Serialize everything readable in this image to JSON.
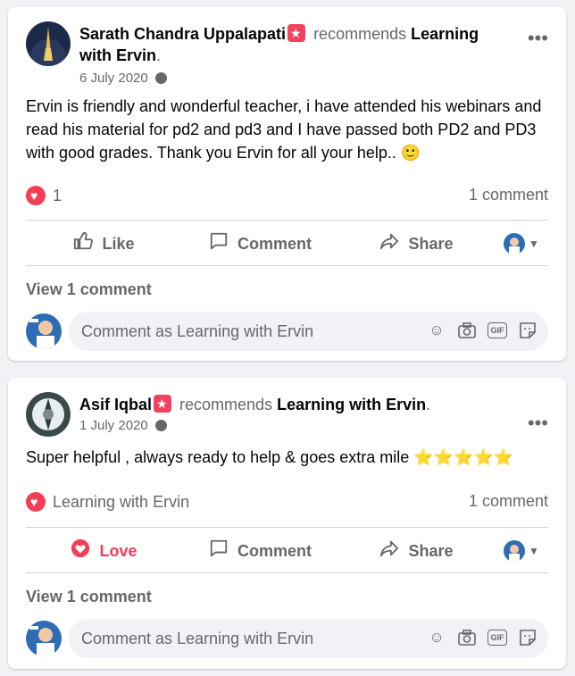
{
  "posts": [
    {
      "author": "Sarath Chandra Uppalapati",
      "recommends_text": "recommends",
      "page_name": "Learning with Ervin",
      "date": "6 July 2020",
      "body": "Ervin is friendly and wonderful teacher, i have attended his webinars and read his material for pd2 and pd3 and I have passed both PD2 and PD3 with good grades. Thank you Ervin for all your help..",
      "body_emoji": "🙂",
      "reaction_count": "1",
      "comment_count": "1 comment",
      "actions": {
        "like": "Like",
        "comment": "Comment",
        "share": "Share"
      },
      "view_comments": "View 1 comment",
      "comment_placeholder": "Comment as Learning with Ervin"
    },
    {
      "author": "Asif Iqbal",
      "recommends_text": "recommends",
      "page_name": "Learning with Ervin",
      "date": "1 July 2020",
      "body": "Super helpful , always ready to help & goes extra mile",
      "body_emoji": "⭐⭐⭐⭐⭐",
      "reaction_by": "Learning with Ervin",
      "comment_count": "1 comment",
      "actions": {
        "like": "Love",
        "comment": "Comment",
        "share": "Share"
      },
      "view_comments": "View 1 comment",
      "comment_placeholder": "Comment as Learning with Ervin"
    }
  ],
  "colors": {
    "accent_red": "#f33e58",
    "recommend_badge": "#f3425f",
    "muted_text": "#65676b"
  },
  "icons": [
    "recommend-badge-icon",
    "globe-icon",
    "more-icon",
    "heart-reaction-icon",
    "like-icon",
    "comment-icon",
    "share-icon",
    "love-icon",
    "emoji-icon",
    "camera-icon",
    "gif-icon",
    "sticker-icon"
  ]
}
